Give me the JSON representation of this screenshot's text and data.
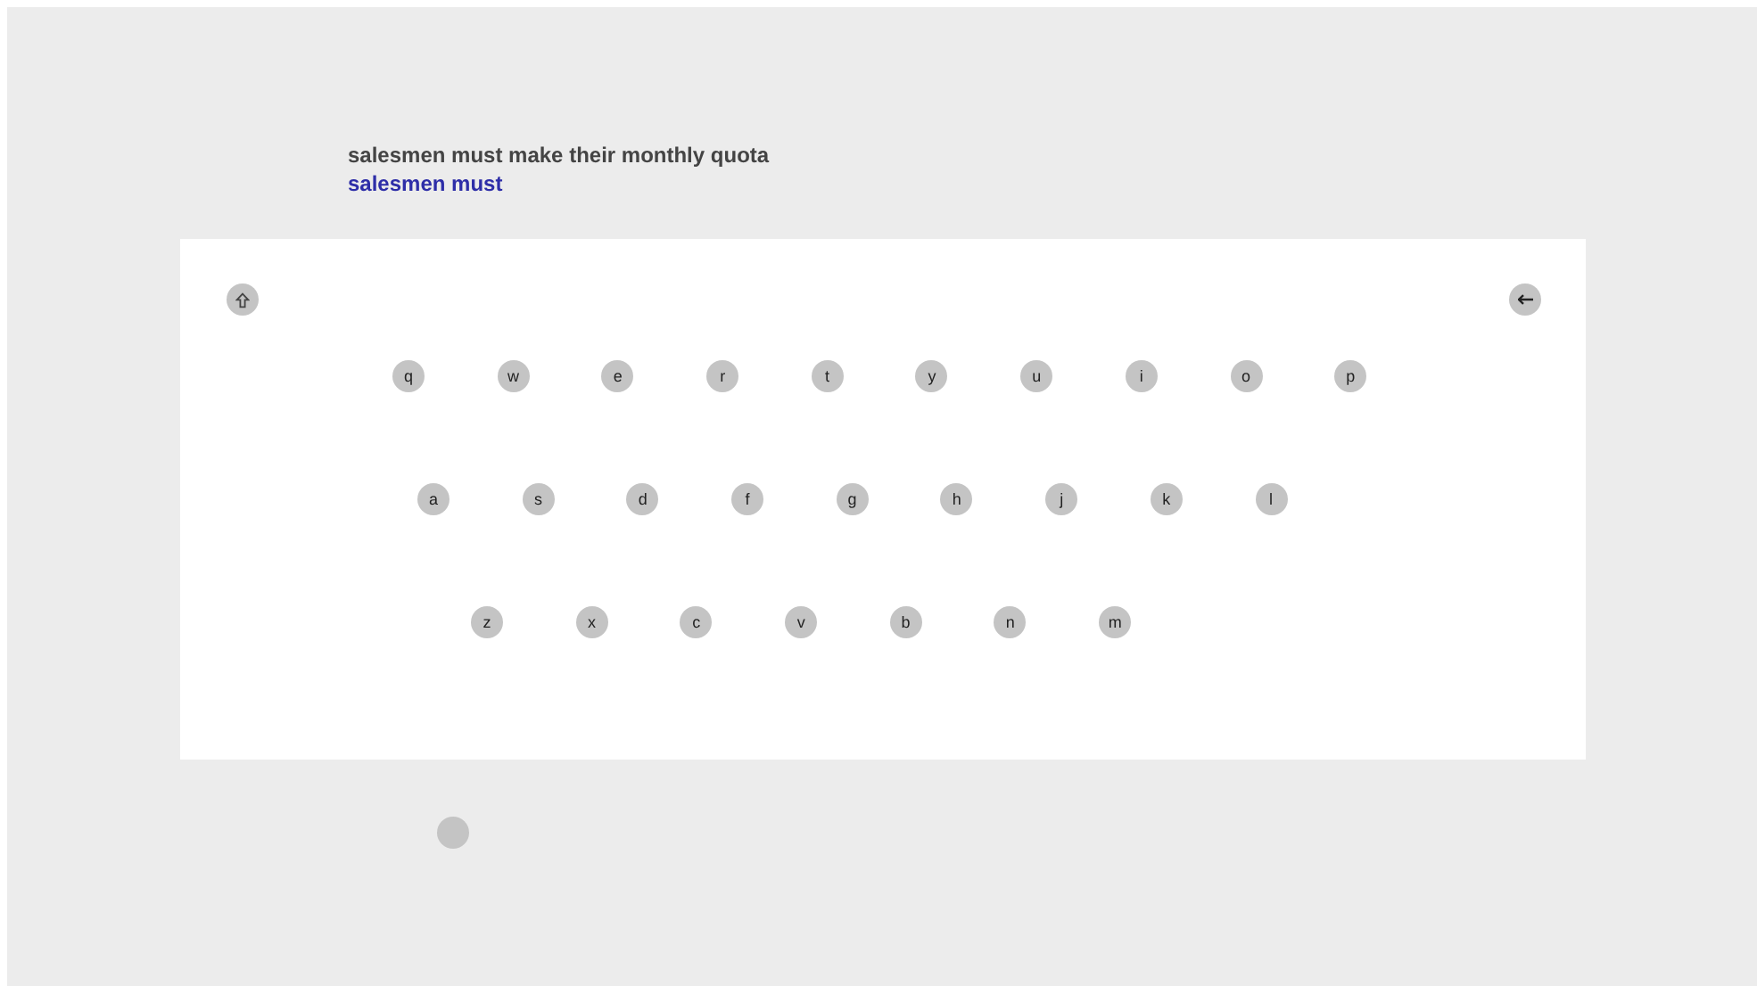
{
  "prompt": {
    "target": "salesmen must make their monthly quota",
    "typed": "salesmen must"
  },
  "keyboard": {
    "rows": [
      [
        "q",
        "w",
        "e",
        "r",
        "t",
        "y",
        "u",
        "i",
        "o",
        "p"
      ],
      [
        "a",
        "s",
        "d",
        "f",
        "g",
        "h",
        "j",
        "k",
        "l"
      ],
      [
        "z",
        "x",
        "c",
        "v",
        "b",
        "n",
        "m"
      ]
    ]
  }
}
